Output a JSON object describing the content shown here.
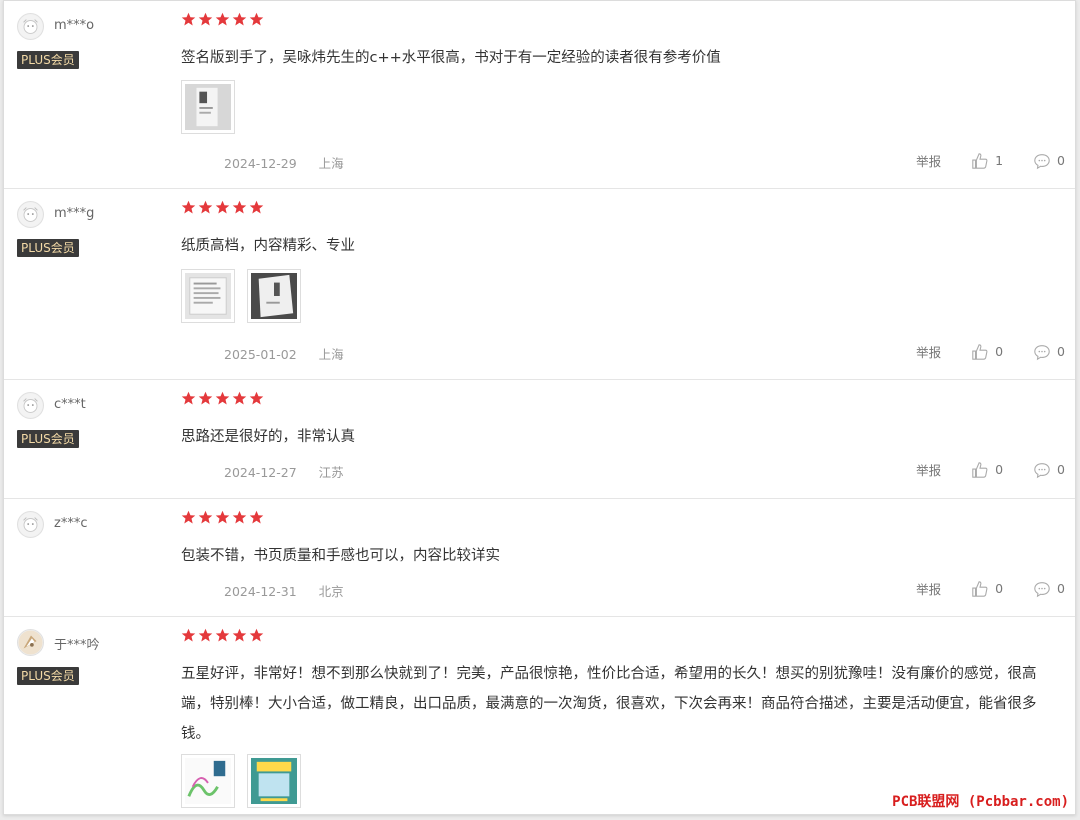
{
  "reviews": [
    {
      "user": "m***o",
      "badge": "PLUS会员",
      "rating": 5,
      "text": "签名版到手了，吴咏炜先生的c++水平很高，书对于有一定经验的读者很有参考价值",
      "date": "2024-12-29",
      "location": "上海",
      "report": "举报",
      "likes": "1",
      "comments": "0"
    },
    {
      "user": "m***g",
      "badge": "PLUS会员",
      "rating": 5,
      "text": "纸质高档，内容精彩、专业",
      "date": "2025-01-02",
      "location": "上海",
      "report": "举报",
      "likes": "0",
      "comments": "0"
    },
    {
      "user": "c***t",
      "badge": "PLUS会员",
      "rating": 5,
      "text": "思路还是很好的，非常认真",
      "date": "2024-12-27",
      "location": "江苏",
      "report": "举报",
      "likes": "0",
      "comments": "0"
    },
    {
      "user": "z***c",
      "badge": "",
      "rating": 5,
      "text": "包装不错，书页质量和手感也可以，内容比较详实",
      "date": "2024-12-31",
      "location": "北京",
      "report": "举报",
      "likes": "0",
      "comments": "0"
    },
    {
      "user": "于***吟",
      "badge": "PLUS会员",
      "rating": 5,
      "text": "五星好评，非常好！想不到那么快就到了！完美，产品很惊艳，性价比合适，希望用的长久！想买的别犹豫哇！没有廉价的感觉，很高端，特别棒！大小合适，做工精良，出口品质，最满意的一次淘货，很喜欢，下次会再来！商品符合描述，主要是活动便宜，能省很多钱。",
      "date": "",
      "location": "",
      "report": "",
      "likes": "",
      "comments": ""
    }
  ],
  "watermark": "PCB联盟网 (Pcbbar.com)",
  "colors": {
    "star": "#e4393c",
    "badge_bg": "#3a3a3a",
    "badge_text": "#f2d9a6",
    "watermark": "#d81e1e"
  }
}
